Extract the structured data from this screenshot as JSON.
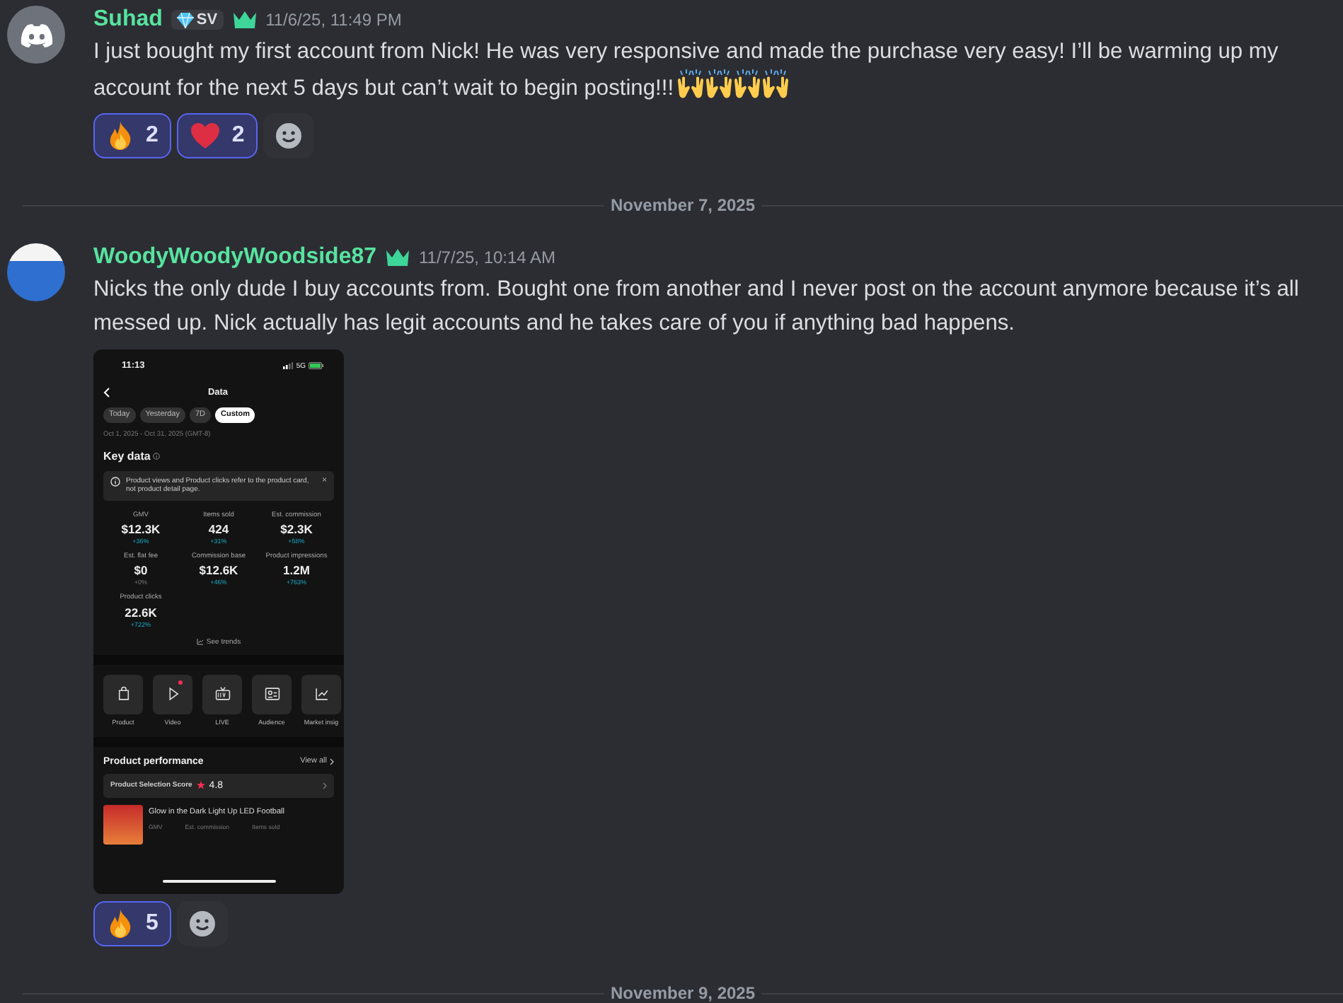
{
  "feed": [
    {
      "kind": "message",
      "author": "Suhad",
      "avatar": {
        "kind": "logo"
      },
      "badge": "SV",
      "crown": true,
      "timestamp": "11/6/25, 11:49 PM",
      "text": "I just bought my first account from Nick! He was very responsive and made the purchase very easy! I’ll be warming up my account for the next 5 days but can’t wait to begin posting!!!",
      "emojis": [
        {
          "kind": "raising_hands"
        },
        {
          "kind": "raising_hands"
        },
        {
          "kind": "raising_hands"
        },
        {
          "kind": "raising_hands"
        }
      ],
      "reactions": [
        {
          "kind": "fire",
          "count": "2",
          "selected": true
        },
        {
          "kind": "heart",
          "count": "2",
          "selected": true
        }
      ]
    },
    {
      "kind": "date_divider",
      "label": "November 7, 2025"
    },
    {
      "kind": "message",
      "author": "WoodyWoodyWoodside87",
      "avatar": {
        "kind": "photo"
      },
      "crown": true,
      "timestamp": "11/7/25, 10:14 AM",
      "text": "Nicks the only dude I buy accounts from. Bought one from another and I never post on the account anymore because it’s all messed up. Nick actually has legit accounts and he takes care of you if anything bad happens.",
      "attachment": {
        "status_time": "11:13",
        "network": "5G",
        "title": "Data",
        "chips": [
          {
            "label": "Today",
            "selected": false
          },
          {
            "label": "Yesterday",
            "selected": false
          },
          {
            "label": "7D",
            "selected": false
          },
          {
            "label": "Custom",
            "selected": true
          }
        ],
        "date_range": "Oct 1, 2025 - Oct 31, 2025 (GMT-8)",
        "section_title": "Key data",
        "notice": "Product views and Product clicks refer to the product card, not product detail page.",
        "notice_close": "×",
        "metrics": [
          {
            "label": "GMV",
            "value": "$12.3K",
            "change": "+36%"
          },
          {
            "label": "Items sold",
            "value": "424",
            "change": "+31%"
          },
          {
            "label": "Est. commission",
            "value": "$2.3K",
            "change": "+58%"
          },
          {
            "label": "Est. flat fee",
            "value": "$0",
            "change": "+0%"
          },
          {
            "label": "Commission base",
            "value": "$12.6K",
            "change": "+46%"
          },
          {
            "label": "Product impressions",
            "value": "1.2M",
            "change": "+763%"
          },
          {
            "label": "Product clicks",
            "value": "22.6K",
            "change": "+722%"
          }
        ],
        "trends_link": "See trends",
        "tools": [
          {
            "kind": "bag",
            "label": "Product",
            "dot": false
          },
          {
            "kind": "play",
            "label": "Video",
            "dot": true
          },
          {
            "kind": "live",
            "label": "LIVE",
            "dot": false
          },
          {
            "kind": "id_card",
            "label": "Audience",
            "dot": false
          },
          {
            "kind": "chart",
            "label": "Market insig",
            "dot": false
          }
        ],
        "performance_title": "Product performance",
        "view_all": "View all",
        "score_label": "Product Selection Score",
        "score": "4.8",
        "product_name": "Glow in the Dark Light Up LED Football",
        "product_columns": [
          "GMV",
          "Est. commission",
          "Items sold"
        ]
      },
      "reactions": [
        {
          "kind": "fire",
          "count": "5",
          "selected": true
        }
      ]
    },
    {
      "kind": "date_divider",
      "label": "November 9, 2025"
    }
  ]
}
